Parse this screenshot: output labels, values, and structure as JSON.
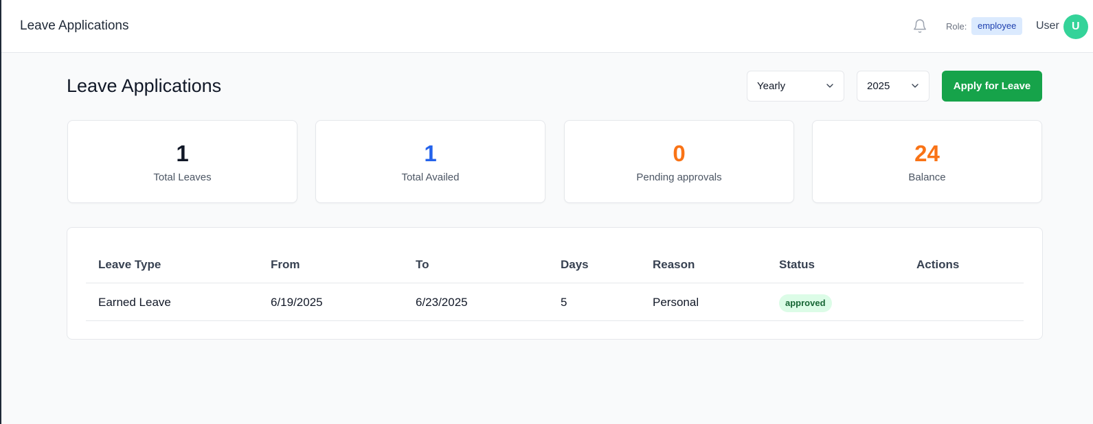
{
  "topbar": {
    "title": "Leave Applications",
    "role_label": "Role:",
    "role": "employee",
    "user": "User",
    "avatar_initial": "U"
  },
  "page": {
    "title": "Leave Applications",
    "period_filter": "Yearly",
    "year_filter": "2025",
    "apply_button": "Apply for Leave"
  },
  "stats": [
    {
      "value": "1",
      "label": "Total Leaves",
      "color": "#111827"
    },
    {
      "value": "1",
      "label": "Total Availed",
      "color": "#2563eb"
    },
    {
      "value": "0",
      "label": "Pending approvals",
      "color": "#f97316"
    },
    {
      "value": "24",
      "label": "Balance",
      "color": "#f97316"
    }
  ],
  "table": {
    "headers": [
      "Leave Type",
      "From",
      "To",
      "Days",
      "Reason",
      "Status",
      "Actions"
    ],
    "rows": [
      {
        "leave_type": "Earned Leave",
        "from": "6/19/2025",
        "to": "6/23/2025",
        "days": "5",
        "reason": "Personal",
        "status": "approved",
        "actions": ""
      }
    ]
  },
  "icons": {
    "notification": "bell-icon",
    "dropdown": "chevron-down-icon"
  }
}
